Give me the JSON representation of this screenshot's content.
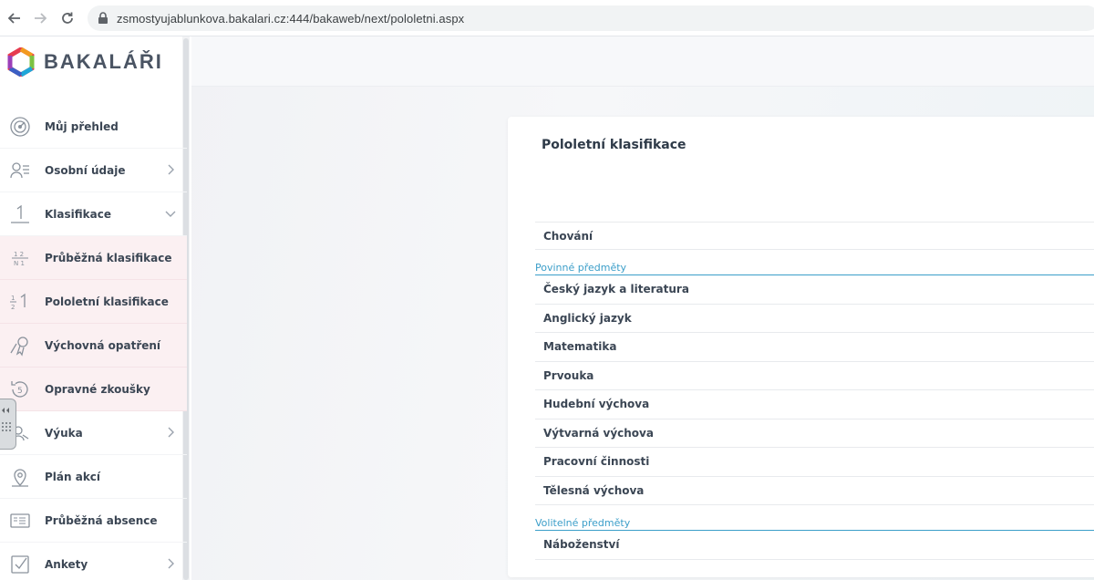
{
  "browser": {
    "url": "zsmostyujablunkova.bakalari.cz:444/bakaweb/next/pololetni.aspx"
  },
  "app": {
    "logo_text": "BAKALÁŘI"
  },
  "sidebar": {
    "items": [
      {
        "label": "Můj přehled",
        "icon": "dashboard-icon",
        "chevron": "none"
      },
      {
        "label": "Osobní údaje",
        "icon": "person-card-icon",
        "chevron": "right"
      },
      {
        "label": "Klasifikace",
        "icon": "grade-one-icon",
        "chevron": "down"
      },
      {
        "label": "Průběžná klasifikace",
        "icon": "grades-grid-icon",
        "chevron": "none",
        "sub": true
      },
      {
        "label": "Pololetní klasifikace",
        "icon": "half-grade-icon",
        "chevron": "none",
        "sub": true
      },
      {
        "label": "Výchovná opatření",
        "icon": "certificate-icon",
        "chevron": "none",
        "sub": true
      },
      {
        "label": "Opravné zkoušky",
        "icon": "retry-five-icon",
        "chevron": "none",
        "sub": true
      },
      {
        "label": "Výuka",
        "icon": "teaching-icon",
        "chevron": "right"
      },
      {
        "label": "Plán akcí",
        "icon": "map-pin-icon",
        "chevron": "none"
      },
      {
        "label": "Průběžná absence",
        "icon": "absence-card-icon",
        "chevron": "none"
      },
      {
        "label": "Ankety",
        "icon": "checkbox-icon",
        "chevron": "right"
      }
    ]
  },
  "card": {
    "title": "Pololetní klasifikace",
    "behavior_row": "Chování",
    "groups": [
      {
        "label": "Povinné předměty",
        "subjects": [
          "Český jazyk a literatura",
          "Anglický jazyk",
          "Matematika",
          "Prvouka",
          "Hudební výchova",
          "Výtvarná výchova",
          "Pracovní činnosti",
          "Tělesná výchova"
        ]
      },
      {
        "label": "Volitelné předměty",
        "subjects": [
          "Náboženství"
        ]
      }
    ]
  },
  "colors": {
    "accent": "#3b9ec9",
    "sub_item_bg": "#fbf0f2",
    "text": "#3b4654"
  }
}
